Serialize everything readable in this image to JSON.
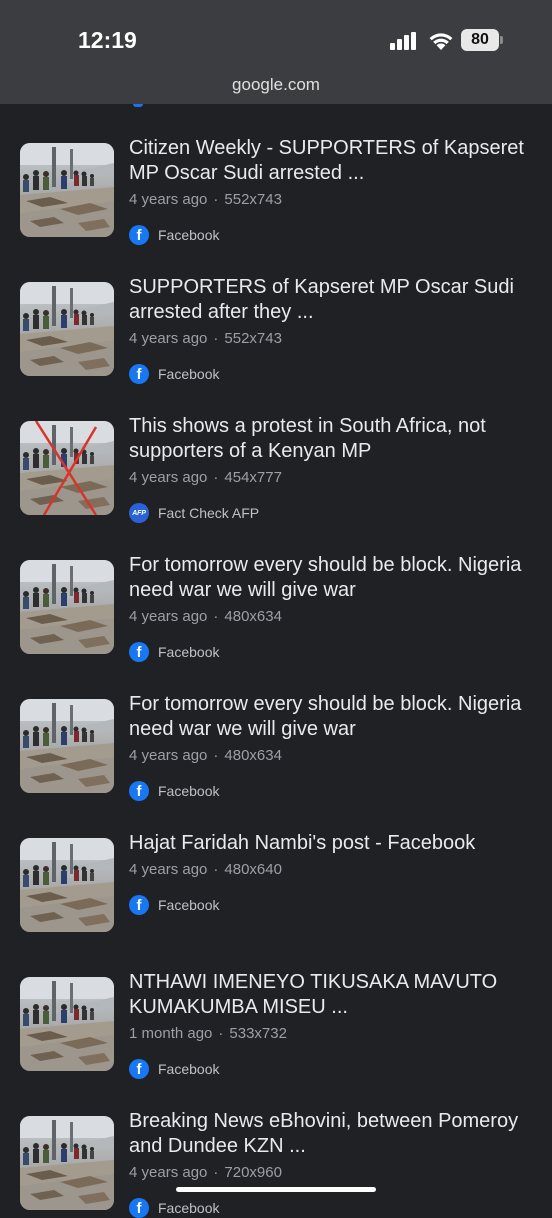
{
  "status_bar": {
    "time": "12:19",
    "battery": "80",
    "signal_icon": "cellular-signal-icon",
    "wifi_icon": "wifi-icon"
  },
  "address_bar": {
    "url": "google.com"
  },
  "colors": {
    "background": "#202124",
    "status_bar": "#3c3d40",
    "facebook": "#1877f2",
    "afp": "#2a63d8"
  },
  "results": [
    {
      "title": "Citizen Weekly - SUPPORTERS of Kapseret MP Oscar Sudi arrested ...",
      "age": "4 years ago",
      "size": "552x743",
      "source": "Facebook",
      "source_icon": "facebook-icon",
      "crossed": false
    },
    {
      "title": "SUPPORTERS of Kapseret MP Oscar Sudi arrested after they ...",
      "age": "4 years ago",
      "size": "552x743",
      "source": "Facebook",
      "source_icon": "facebook-icon",
      "crossed": false
    },
    {
      "title": "This shows a protest in South Africa, not supporters of a Kenyan MP",
      "age": "4 years ago",
      "size": "454x777",
      "source": "Fact Check AFP",
      "source_icon": "afp-icon",
      "source_icon_text": "AFP",
      "crossed": true
    },
    {
      "title": "For tomorrow every should be block. Nigeria need war we will give war",
      "age": "4 years ago",
      "size": "480x634",
      "source": "Facebook",
      "source_icon": "facebook-icon",
      "crossed": false
    },
    {
      "title": "For tomorrow every should be block. Nigeria need war we will give war",
      "age": "4 years ago",
      "size": "480x634",
      "source": "Facebook",
      "source_icon": "facebook-icon",
      "crossed": false
    },
    {
      "title": "Hajat Faridah Nambi's post - Facebook",
      "age": "4 years ago",
      "size": "480x640",
      "source": "Facebook",
      "source_icon": "facebook-icon",
      "crossed": false
    },
    {
      "title": "NTHAWI IMENEYO TIKUSAKA MAVUTO KUMAKUMBA MISEU ...",
      "age": "1 month ago",
      "size": "533x732",
      "source": "Facebook",
      "source_icon": "facebook-icon",
      "crossed": false
    },
    {
      "title": "Breaking News eBhovini, between Pomeroy and Dundee KZN ...",
      "age": "4 years ago",
      "size": "720x960",
      "source": "Facebook",
      "source_icon": "facebook-icon",
      "crossed": false
    }
  ]
}
